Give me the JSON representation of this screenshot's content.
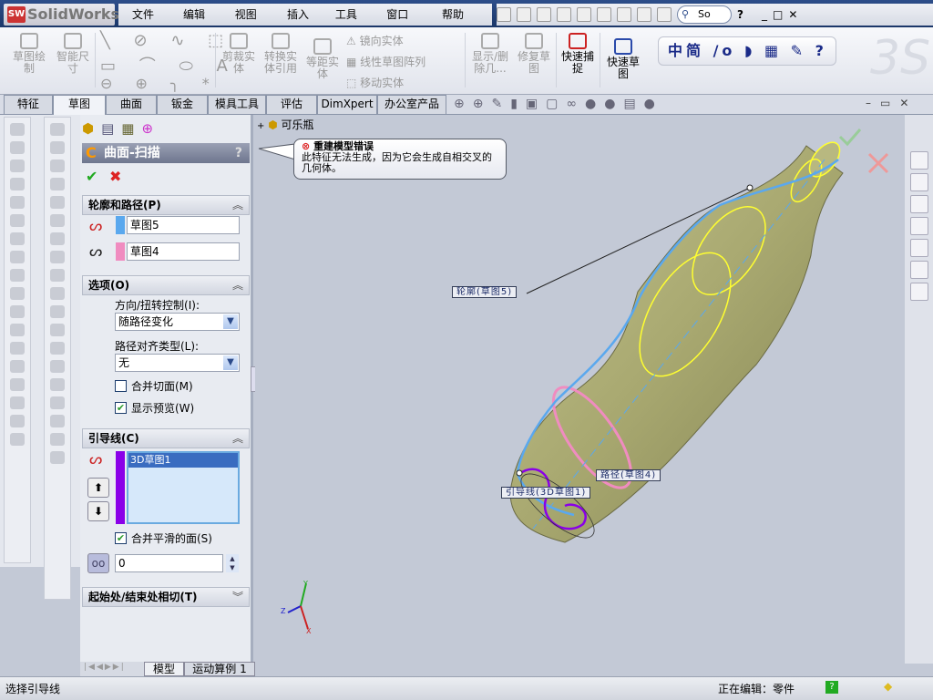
{
  "app": {
    "name": "SolidWorks"
  },
  "menu": [
    "文件(F)",
    "编辑(E)",
    "视图(V)",
    "插入(I)",
    "工具(T)",
    "窗口(W)",
    "帮助(H)"
  ],
  "search": {
    "value": "So"
  },
  "ribbon": {
    "sketch": "草图绘\n制",
    "smart_dim": "智能尺\n寸",
    "trim": "剪裁实\n体",
    "convert": "转换实\n体引用",
    "offset": "等距实\n体",
    "mirror": "镜向实体",
    "linear_pattern": "线性草图阵列",
    "move": "移动实体",
    "show_delete": "显示/删\n除几...",
    "repair": "修复草\n图",
    "quick_snap": "快速捕\n捉",
    "rapid_sketch": "快速草\n图"
  },
  "ime_bar": "中简 /o ◗ ▦ ✎ ? ",
  "tabs": [
    "特征",
    "草图",
    "曲面",
    "钣金",
    "模具工具",
    "评估",
    "DimXpert",
    "办公室产品"
  ],
  "active_tab": "草图",
  "feature_tree": {
    "root": "可乐瓶"
  },
  "property_manager": {
    "title": "曲面-扫描",
    "help": "?",
    "profile_path": {
      "header": "轮廓和路径(P)",
      "profile": "草图5",
      "path": "草图4",
      "profile_color": "#5aa8ee",
      "path_color": "#f08cc0"
    },
    "options": {
      "header": "选项(O)",
      "orient_label": "方向/扭转控制(I):",
      "orient_value": "随路径变化",
      "align_label": "路径对齐类型(L):",
      "align_value": "无",
      "merge_tangent": "合并切面(M)",
      "merge_tangent_checked": false,
      "show_preview": "显示预览(W)",
      "show_preview_checked": true
    },
    "guides": {
      "header": "引导线(C)",
      "items": [
        "3D草图1"
      ],
      "guide_color": "#8a00e8",
      "merge_smooth": "合并平滑的面(S)",
      "merge_smooth_checked": true,
      "value": "0"
    },
    "tangency": {
      "header": "起始处/结束处相切(T)"
    }
  },
  "error_tooltip": {
    "title": "重建模型错误",
    "message": "此特征无法生成，因为它会生成自相交叉的几何体。"
  },
  "callouts": {
    "profile": "轮廓(草图5)",
    "path": "路径(草图4)",
    "guide": "引导线(3D草图1)"
  },
  "triad": {
    "x": "X",
    "y": "Y",
    "z": "Z"
  },
  "bottom_tabs": [
    "模型",
    "运动算例 1"
  ],
  "status": {
    "left": "选择引导线",
    "editing": "正在编辑：零件"
  },
  "colors": {
    "model": "#a8a870",
    "accent": "#2d4e8a"
  }
}
